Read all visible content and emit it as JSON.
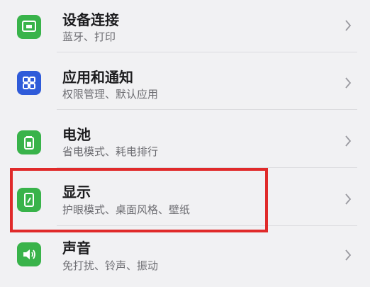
{
  "settings": {
    "items": [
      {
        "title": "设备连接",
        "subtitle": "蓝牙、打印",
        "icon": "device-connection-icon",
        "icon_color": "#39b34a"
      },
      {
        "title": "应用和通知",
        "subtitle": "权限管理、默认应用",
        "icon": "apps-grid-icon",
        "icon_color": "#2f5bd9"
      },
      {
        "title": "电池",
        "subtitle": "省电模式、耗电排行",
        "icon": "battery-icon",
        "icon_color": "#39b34a"
      },
      {
        "title": "显示",
        "subtitle": "护眼模式、桌面风格、壁纸",
        "icon": "display-icon",
        "icon_color": "#39b34a"
      },
      {
        "title": "声音",
        "subtitle": "免打扰、铃声、振动",
        "icon": "speaker-icon",
        "icon_color": "#39b34a"
      }
    ]
  },
  "highlight_color": "#e02a2a"
}
